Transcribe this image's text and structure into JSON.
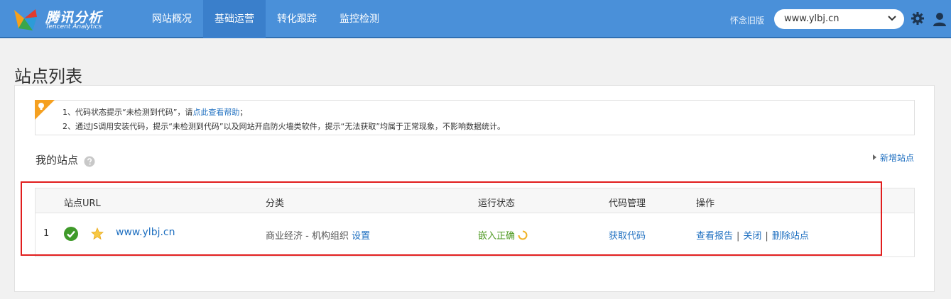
{
  "header": {
    "logo_cn": "腾讯分析",
    "logo_en": "Tencent Analytics",
    "nav": [
      {
        "label": "网站概况",
        "active": false
      },
      {
        "label": "基础运营",
        "active": true
      },
      {
        "label": "转化跟踪",
        "active": false
      },
      {
        "label": "监控检测",
        "active": false
      }
    ],
    "old_version": "怀念旧版",
    "site_select": "www.ylbj.cn"
  },
  "page": {
    "title": "站点列表",
    "notice": {
      "line1_before": "1、代码状态提示“未检测到代码”，请",
      "line1_link": "点此查看帮助",
      "line1_after": "；",
      "line2": "2、通过JS调用安装代码，提示“未检测到代码”以及网站开启防火墙类软件，提示“无法获取”均属于正常现象，不影响数据统计。"
    },
    "my_sites_label": "我的站点",
    "new_site_label": "新增站点",
    "table": {
      "headers": [
        "站点URL",
        "分类",
        "运行状态",
        "代码管理",
        "操作"
      ],
      "rows": [
        {
          "index": "1",
          "url": "www.ylbj.cn",
          "category": "商业经济 - 机构组织",
          "category_action": "设置",
          "status": "嵌入正确",
          "code_action": "获取代码",
          "actions": [
            "查看报告",
            "关闭",
            "删除站点"
          ],
          "separator": "|"
        }
      ]
    }
  },
  "colors": {
    "topbar": "#4a90d9",
    "link": "#1e6fc0",
    "status_ok": "#4f9a23",
    "highlight": "#e11d1d"
  }
}
